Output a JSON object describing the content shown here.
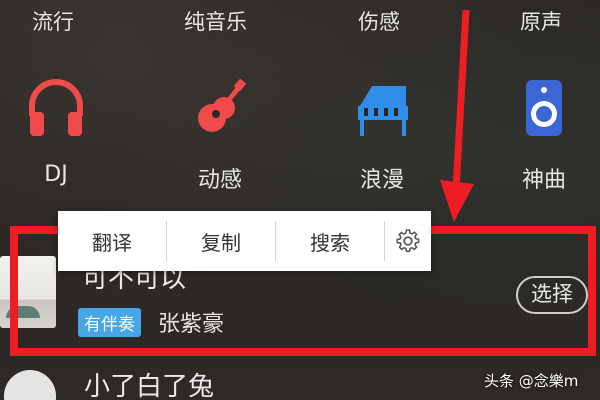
{
  "top_categories": [
    "流行",
    "纯音乐",
    "伤感",
    "原声"
  ],
  "icon_categories": [
    {
      "label": "DJ",
      "icon": "headphones-icon",
      "color": "#f04b4b"
    },
    {
      "label": "动感",
      "icon": "guitar-icon",
      "color": "#f04b4b"
    },
    {
      "label": "浪漫",
      "icon": "piano-icon",
      "color": "#2f8ee8"
    },
    {
      "label": "神曲",
      "icon": "speaker-icon",
      "color": "#3b67d6"
    }
  ],
  "context_menu": {
    "translate": "翻译",
    "copy": "复制",
    "search": "搜索",
    "settings_icon": "gear-icon"
  },
  "song": {
    "title": "可不可以",
    "badge": "有伴奏",
    "artist": "张紫豪",
    "select_label": "选择"
  },
  "next_song": {
    "title": "小了白了兔"
  },
  "watermark": "头条 @念樂m",
  "colors": {
    "highlight_red": "#ec1e24",
    "badge_blue": "#47a6e6"
  }
}
